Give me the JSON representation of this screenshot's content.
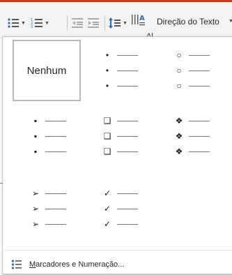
{
  "toolbar": {
    "text_direction_label": "Direção do Texto",
    "partial_text": "Al..."
  },
  "menu": {
    "none_label": "Nenhum",
    "footer_label": "Marcadores e Numeração...",
    "footer_accel": "M",
    "footer_rest": "arcadores e Numeração..."
  },
  "bullet_styles": [
    [
      "",
      "•",
      "○"
    ],
    [
      "▪",
      "❑",
      "❖"
    ],
    [
      "➢",
      "✓",
      ""
    ]
  ],
  "colors": {
    "accent": "#c43e1c",
    "selection_border": "#b8b8b8",
    "ribbon_bg": "#f3f3f3"
  }
}
